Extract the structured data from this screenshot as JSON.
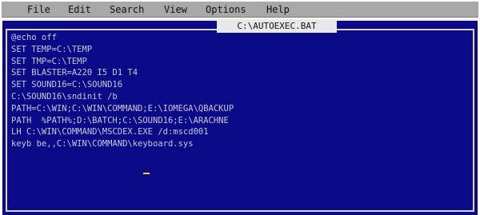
{
  "menubar": {
    "items": [
      "File",
      "Edit",
      "Search",
      "View",
      "Options",
      "Help"
    ]
  },
  "editor": {
    "filename": "C:\\AUTOEXEC.BAT",
    "lines": [
      "@echo off",
      "SET TEMP=C:\\TEMP",
      "SET TMP=C:\\TEMP",
      "SET BLASTER=A220 I5 D1 T4",
      "SET SOUND16=C:\\SOUND16",
      "C:\\SOUND16\\sndinit /b",
      "PATH=C:\\WIN;C:\\WIN\\COMMAND;E:\\IOMEGA\\QBACKUP",
      "PATH  %PATH%;D:\\BATCH;C:\\SOUND16;E:\\ARACHNE",
      "LH C:\\WIN\\COMMAND\\MSCDEX.EXE /d:mscd001",
      "keyb be,,C:\\WIN\\COMMAND\\keyboard.sys"
    ]
  },
  "colors": {
    "background": "#0a0a88",
    "text": "#c8c8d8",
    "menubar": "#a8a8a8",
    "cursor": "#ffd800"
  }
}
